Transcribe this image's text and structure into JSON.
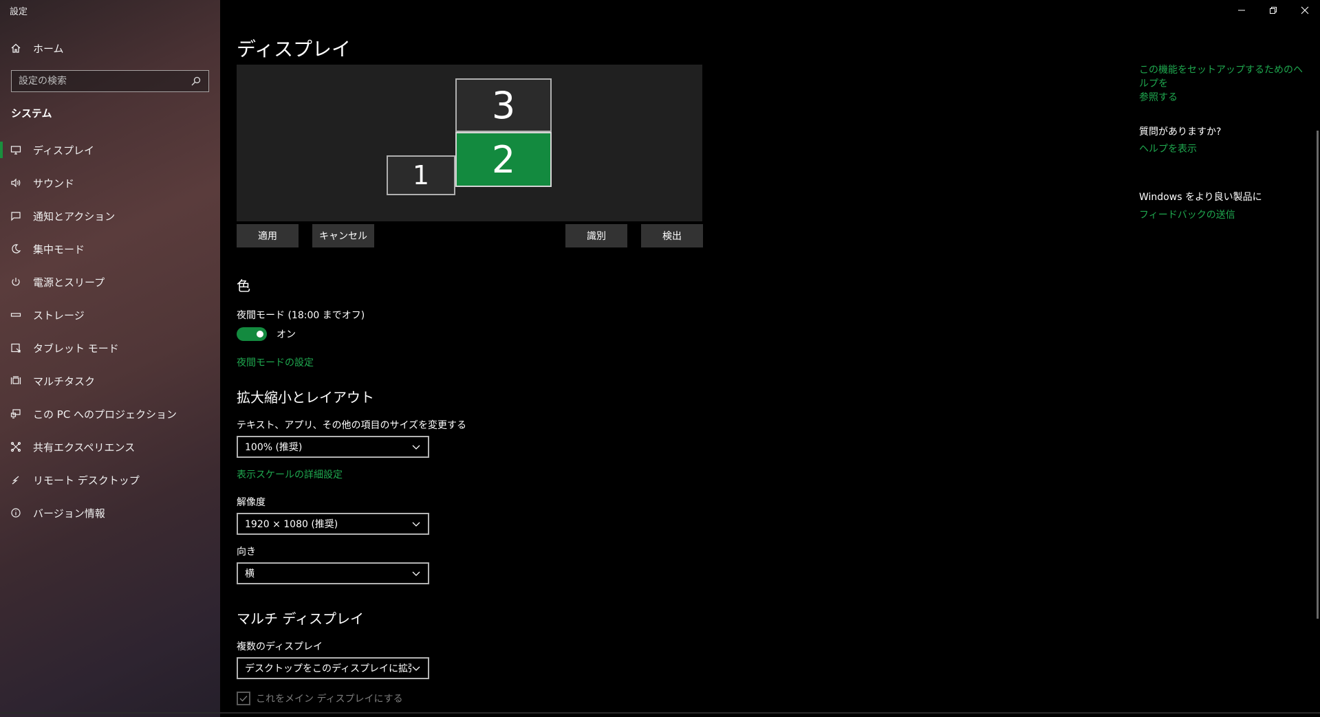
{
  "app": {
    "title": "設定"
  },
  "window_controls": {
    "minimize": "minimize-icon",
    "restore": "restore-icon",
    "close": "close-icon"
  },
  "sidebar": {
    "home_label": "ホーム",
    "search_placeholder": "設定の検索",
    "section": "システム",
    "items": [
      {
        "label": "ディスプレイ",
        "icon": "monitor-icon",
        "active": true
      },
      {
        "label": "サウンド",
        "icon": "speaker-icon",
        "active": false
      },
      {
        "label": "通知とアクション",
        "icon": "message-icon",
        "active": false
      },
      {
        "label": "集中モード",
        "icon": "moon-icon",
        "active": false
      },
      {
        "label": "電源とスリープ",
        "icon": "power-icon",
        "active": false
      },
      {
        "label": "ストレージ",
        "icon": "storage-icon",
        "active": false
      },
      {
        "label": "タブレット モード",
        "icon": "tablet-icon",
        "active": false
      },
      {
        "label": "マルチタスク",
        "icon": "multitask-icon",
        "active": false
      },
      {
        "label": "この PC へのプロジェクション",
        "icon": "projection-icon",
        "active": false
      },
      {
        "label": "共有エクスペリエンス",
        "icon": "shared-icon",
        "active": false
      },
      {
        "label": "リモート デスクトップ",
        "icon": "remote-icon",
        "active": false
      },
      {
        "label": "バージョン情報",
        "icon": "info-icon",
        "active": false
      }
    ]
  },
  "main": {
    "title": "ディスプレイ",
    "monitors": [
      {
        "number": "3",
        "selected": false
      },
      {
        "number": "2",
        "selected": true
      },
      {
        "number": "1",
        "selected": false
      }
    ],
    "buttons": {
      "apply": "適用",
      "cancel": "キャンセル",
      "identify": "識別",
      "detect": "検出"
    },
    "color": {
      "heading": "色",
      "night_light_label": "夜間モード (18:00 までオフ)",
      "night_light_state": "オン",
      "night_light_on": true,
      "night_light_settings_link": "夜間モードの設定"
    },
    "scale": {
      "heading": "拡大縮小とレイアウト",
      "size_label": "テキスト、アプリ、その他の項目のサイズを変更する",
      "size_value": "100% (推奨)",
      "advanced_link": "表示スケールの詳細設定",
      "resolution_label": "解像度",
      "resolution_value": "1920 × 1080 (推奨)",
      "orientation_label": "向き",
      "orientation_value": "横"
    },
    "multi": {
      "heading": "マルチ ディスプレイ",
      "label": "複数のディスプレイ",
      "value": "デスクトップをこのディスプレイに拡張する",
      "main_display_label": "これをメイン ディスプレイにする",
      "main_display_checked": true
    }
  },
  "right_panel": {
    "setup_help_link_line1": "この機能をセットアップするためのヘルプを",
    "setup_help_link_line2": "参照する",
    "question_heading": "質問がありますか?",
    "help_link": "ヘルプを表示",
    "feedback_heading": "Windows をより良い製品に",
    "feedback_link": "フィードバックの送信"
  },
  "colors": {
    "accent": "#138a3f",
    "link": "#1fa84f"
  }
}
